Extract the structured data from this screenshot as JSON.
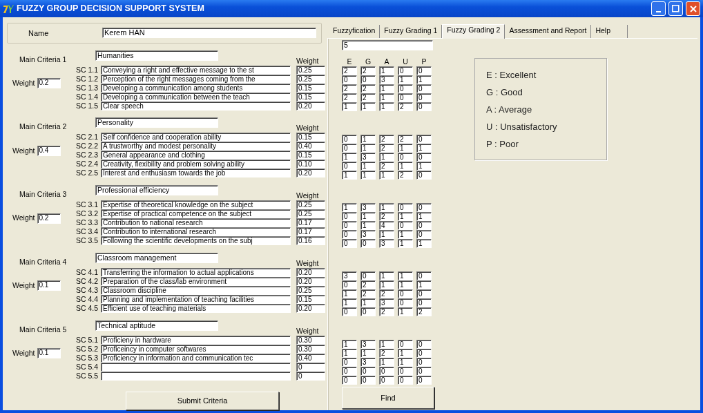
{
  "window": {
    "title": "FUZZY GROUP DECISION SUPPORT SYSTEM"
  },
  "name": {
    "label": "Name",
    "value": "Kerem HAN"
  },
  "criteria": [
    {
      "label": "Main Criteria 1",
      "name": "Humanities",
      "weight_label": "Weight",
      "weight": "0.2",
      "weight_header": "Weight",
      "subcriteria": [
        {
          "code": "SC 1.1",
          "text": "Conveying a right and effective message to the st",
          "weight": "0.25"
        },
        {
          "code": "SC 1.2",
          "text": "Perception of the right messages coming from the",
          "weight": "0.25"
        },
        {
          "code": "SC 1.3",
          "text": "Developing a communication among students",
          "weight": "0.15"
        },
        {
          "code": "SC 1.4",
          "text": "Developing a communication between the teach",
          "weight": "0.15"
        },
        {
          "code": "SC 1.5",
          "text": "Clear speech",
          "weight": "0.20"
        }
      ]
    },
    {
      "label": "Main Criteria 2",
      "name": "Personality",
      "weight_label": "Weight",
      "weight": "0.4",
      "weight_header": "Weight",
      "subcriteria": [
        {
          "code": "SC 2.1",
          "text": "Self confidence and cooperation ability",
          "weight": "0.15"
        },
        {
          "code": "SC 2.2",
          "text": "A trustworthy and modest personality",
          "weight": "0.40"
        },
        {
          "code": "SC 2.3",
          "text": "General appearance and clothing",
          "weight": "0.15"
        },
        {
          "code": "SC 2.4",
          "text": "Creativity, flexibility and problem solving ability",
          "weight": "0.10"
        },
        {
          "code": "SC 2.5",
          "text": "Interest and enthusiasm towards the job",
          "weight": "0.20"
        }
      ]
    },
    {
      "label": "Main Criteria 3",
      "name": "Professional efficiency",
      "weight_label": "Weight",
      "weight": "0.2",
      "weight_header": "Weight",
      "subcriteria": [
        {
          "code": "SC 3.1",
          "text": "Expertise of theoretical knowledge on the subject",
          "weight": "0.25"
        },
        {
          "code": "SC 3.2",
          "text": "Expertise of practical competence on the subject",
          "weight": "0.25"
        },
        {
          "code": "SC 3.3",
          "text": "Contribution to national research",
          "weight": "0.17"
        },
        {
          "code": "SC 3.4",
          "text": "Contribution to international research",
          "weight": "0.17"
        },
        {
          "code": "SC 3.5",
          "text": "Following the scientific developments on the subj",
          "weight": "0.16"
        }
      ]
    },
    {
      "label": "Main Criteria 4",
      "name": "Classroom management",
      "weight_label": "Weight",
      "weight": "0.1",
      "weight_header": "Weight",
      "subcriteria": [
        {
          "code": "SC 4.1",
          "text": "Transferring the information to actual applications",
          "weight": "0.20"
        },
        {
          "code": "SC 4.2",
          "text": "Preparation of the class/lab environment",
          "weight": "0.20"
        },
        {
          "code": "SC 4.3",
          "text": "Classroom discipline",
          "weight": "0.25"
        },
        {
          "code": "SC 4.4",
          "text": "Planning and implementation of teaching facilities",
          "weight": "0.15"
        },
        {
          "code": "SC 4.5",
          "text": "Efficient use of teaching materials",
          "weight": "0.20"
        }
      ]
    },
    {
      "label": "Main Criteria 5",
      "name": "Technical aptitude",
      "weight_label": "Weight",
      "weight": "0.1",
      "weight_header": "Weight",
      "subcriteria": [
        {
          "code": "SC 5.1",
          "text": "Proficieny in hardware",
          "weight": "0.30"
        },
        {
          "code": "SC 5.2",
          "text": "Proficeincy in computer softwares",
          "weight": "0.30"
        },
        {
          "code": "SC 5.3",
          "text": "Proficiency in information and communication tec",
          "weight": "0.40"
        },
        {
          "code": "SC 5.4",
          "weight": "0"
        },
        {
          "code": "SC 5.5",
          "weight": "0"
        }
      ]
    }
  ],
  "submit_button": "Submit Criteria",
  "tabs": [
    {
      "label": "Fuzzyfication",
      "selected": false
    },
    {
      "label": "Fuzzy Grading 1",
      "selected": false
    },
    {
      "label": "Fuzzy Grading 2",
      "selected": true
    },
    {
      "label": "Assessment and Report",
      "selected": false
    },
    {
      "label": "Help",
      "selected": false
    }
  ],
  "expert_count": "5",
  "grade_headers": [
    "E",
    "G",
    "A",
    "U",
    "P"
  ],
  "grades": [
    [
      [
        "2",
        "2",
        "1",
        "0",
        "0"
      ],
      [
        "0",
        "0",
        "3",
        "1",
        "1"
      ],
      [
        "2",
        "2",
        "1",
        "0",
        "0"
      ],
      [
        "2",
        "2",
        "1",
        "0",
        "0"
      ],
      [
        "1",
        "1",
        "1",
        "2",
        "0"
      ]
    ],
    [
      [
        "0",
        "1",
        "2",
        "2",
        "0"
      ],
      [
        "0",
        "1",
        "2",
        "1",
        "1"
      ],
      [
        "1",
        "3",
        "1",
        "0",
        "0"
      ],
      [
        "0",
        "1",
        "2",
        "1",
        "1"
      ],
      [
        "1",
        "1",
        "1",
        "2",
        "0"
      ]
    ],
    [
      [
        "1",
        "3",
        "1",
        "0",
        "0"
      ],
      [
        "0",
        "1",
        "2",
        "1",
        "1"
      ],
      [
        "0",
        "1",
        "4",
        "0",
        "0"
      ],
      [
        "0",
        "3",
        "1",
        "1",
        "0"
      ],
      [
        "0",
        "0",
        "3",
        "1",
        "1"
      ]
    ],
    [
      [
        "3",
        "0",
        "1",
        "1",
        "0"
      ],
      [
        "0",
        "2",
        "1",
        "1",
        "1"
      ],
      [
        "1",
        "2",
        "2",
        "0",
        "0"
      ],
      [
        "1",
        "1",
        "3",
        "0",
        "0"
      ],
      [
        "0",
        "0",
        "2",
        "1",
        "2"
      ]
    ],
    [
      [
        "1",
        "3",
        "1",
        "0",
        "0"
      ],
      [
        "1",
        "1",
        "2",
        "1",
        "0"
      ],
      [
        "0",
        "3",
        "1",
        "1",
        "0"
      ],
      [
        "0",
        "0",
        "0",
        "0",
        "0"
      ],
      [
        "0",
        "0",
        "0",
        "0",
        "0"
      ]
    ]
  ],
  "legend": [
    "E : Excellent",
    "G : Good",
    "A  : Average",
    "U : Unsatisfactory",
    "P : Poor"
  ],
  "find_button": "Find"
}
